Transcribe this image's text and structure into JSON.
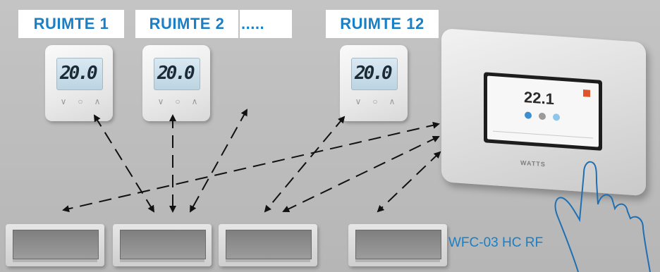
{
  "rooms": [
    {
      "label": "RUIMTE 1"
    },
    {
      "label": "RUIMTE 2"
    },
    {
      "label": "....."
    },
    {
      "label": "RUIMTE 12"
    }
  ],
  "thermostats": [
    {
      "display": "20.0"
    },
    {
      "display": "20.0"
    },
    {
      "display": "20.0"
    }
  ],
  "hub": {
    "temperature": "22.1",
    "brand": "WATTS"
  },
  "receiver": {
    "model": "WFC-03 HC RF"
  },
  "colors": {
    "accent": "#1a7fc4",
    "background": "#bdbdbd",
    "arrow": "#111111"
  }
}
